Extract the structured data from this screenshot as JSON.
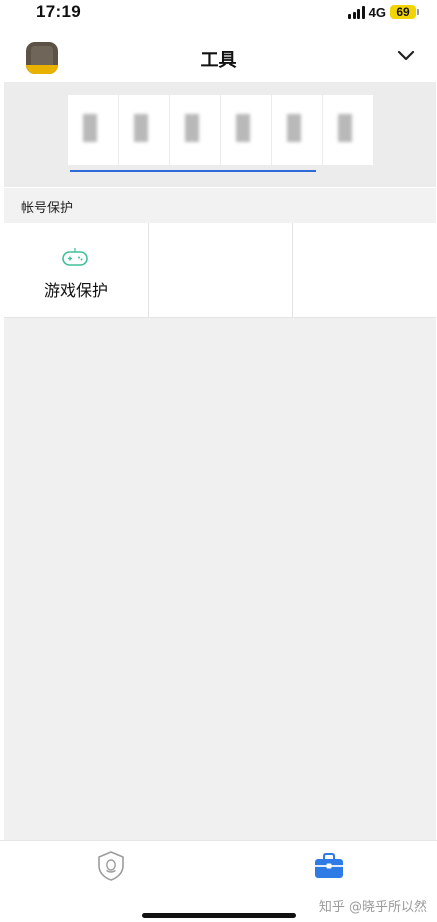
{
  "status_bar": {
    "time": "17:19",
    "network": "4G",
    "battery": "69",
    "battery_color": "#f2d400"
  },
  "header": {
    "title": "工具",
    "avatar_icon": "user-avatar",
    "menu_icon": "chevron-down-icon"
  },
  "account_banner": {
    "digits_visible": false,
    "underline_color": "#2f6bd8"
  },
  "section": {
    "title": "帐号保护"
  },
  "tools": [
    {
      "label": "游戏保护",
      "icon": "gamepad-icon",
      "icon_color": "#3fbf9a"
    },
    {
      "label": ""
    },
    {
      "label": ""
    }
  ],
  "bottom_tabs": [
    {
      "icon": "qq-shield-icon",
      "active": false
    },
    {
      "icon": "toolbox-icon",
      "active": true,
      "color": "#2f7be5"
    }
  ],
  "watermark": "知乎 @晓乎所以然"
}
